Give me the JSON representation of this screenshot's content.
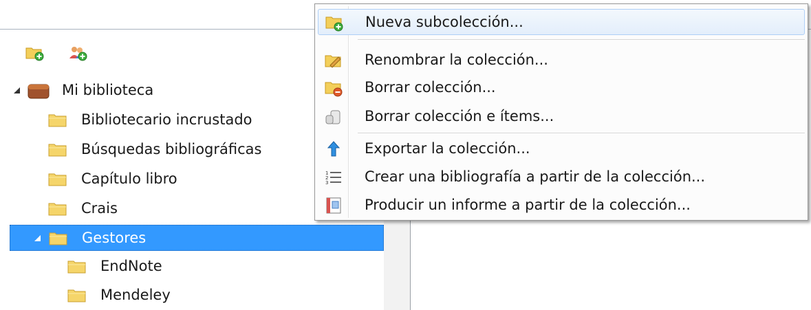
{
  "menu": {
    "items": [
      {
        "label": "Nueva subcolección...",
        "icon": "new-subcollection-icon"
      },
      {
        "label": "Renombrar la colección...",
        "icon": "rename-icon"
      },
      {
        "label": "Borrar colección...",
        "icon": "delete-collection-icon"
      },
      {
        "label": "Borrar colección e ítems...",
        "icon": "trash-icon"
      },
      {
        "label": "Exportar la colección...",
        "icon": "export-icon"
      },
      {
        "label": "Crear una bibliografía a partir de la colección...",
        "icon": "bibliography-icon"
      },
      {
        "label": "Producir un informe a partir de la colección...",
        "icon": "report-icon"
      }
    ]
  },
  "toolbar": {
    "buttons": [
      {
        "icon": "new-collection-icon"
      },
      {
        "icon": "new-group-icon"
      }
    ]
  },
  "tree": {
    "items": [
      {
        "label": "Mi biblioteca",
        "icon": "library-icon"
      },
      {
        "label": "Bibliotecario incrustado",
        "icon": "folder-icon"
      },
      {
        "label": "Búsquedas bibliográficas",
        "icon": "folder-icon"
      },
      {
        "label": "Capítulo libro",
        "icon": "folder-icon"
      },
      {
        "label": "Crais",
        "icon": "folder-icon"
      },
      {
        "label": "Gestores",
        "icon": "folder-icon",
        "selected": true
      },
      {
        "label": "EndNote",
        "icon": "folder-icon"
      },
      {
        "label": "Mendeley",
        "icon": "folder-icon"
      }
    ]
  },
  "colors": {
    "selection": "#3399ff",
    "folder": "#f5d56a"
  }
}
